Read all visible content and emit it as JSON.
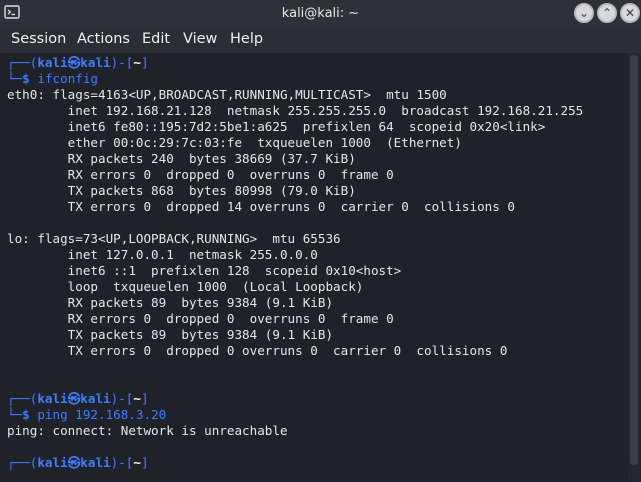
{
  "window": {
    "title": "kali@kali: ~",
    "controls": {
      "minimize": "⌄",
      "maximize": "⌃",
      "close": "✕"
    }
  },
  "menu": {
    "session": "Session",
    "actions": "Actions",
    "edit": "Edit",
    "view": "View",
    "help": "Help"
  },
  "prompt": {
    "corner_top": "┌──(",
    "user": "kali",
    "at": "㉿",
    "host": "kali",
    "close_open": ")-[",
    "path": "~",
    "close": "]",
    "corner_bottom": "└─",
    "dollar": "$"
  },
  "commands": {
    "first": "ifconfig",
    "second": "ping 192.168.3.20"
  },
  "output": {
    "eth0": [
      "eth0: flags=4163<UP,BROADCAST,RUNNING,MULTICAST>  mtu 1500",
      "        inet 192.168.21.128  netmask 255.255.255.0  broadcast 192.168.21.255",
      "        inet6 fe80::195:7d2:5be1:a625  prefixlen 64  scopeid 0x20<link>",
      "        ether 00:0c:29:7c:03:fe  txqueuelen 1000  (Ethernet)",
      "        RX packets 240  bytes 38669 (37.7 KiB)",
      "        RX errors 0  dropped 0  overruns 0  frame 0",
      "        TX packets 868  bytes 80998 (79.0 KiB)",
      "        TX errors 0  dropped 14 overruns 0  carrier 0  collisions 0"
    ],
    "lo": [
      "lo: flags=73<UP,LOOPBACK,RUNNING>  mtu 65536",
      "        inet 127.0.0.1  netmask 255.0.0.0",
      "        inet6 ::1  prefixlen 128  scopeid 0x10<host>",
      "        loop  txqueuelen 1000  (Local Loopback)",
      "        RX packets 89  bytes 9384 (9.1 KiB)",
      "        RX errors 0  dropped 0  overruns 0  frame 0",
      "        TX packets 89  bytes 9384 (9.1 KiB)",
      "        TX errors 0  dropped 0 overruns 0  carrier 0  collisions 0"
    ],
    "ping_error": "ping: connect: Network is unreachable"
  },
  "colors": {
    "background": "#1f2229",
    "prompt_blue": "#3d7eff",
    "text": "#e6e6e6"
  }
}
